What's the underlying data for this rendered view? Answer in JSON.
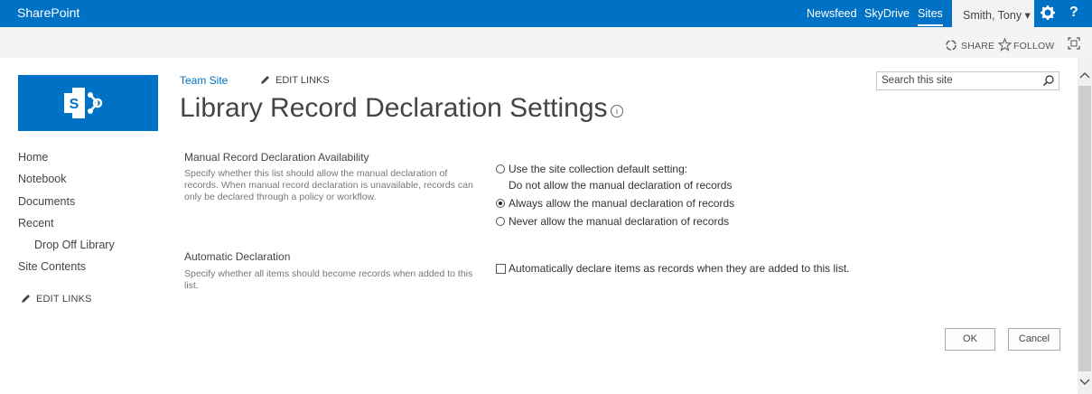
{
  "suitebar": {
    "brand": "SharePoint",
    "links": [
      "Newsfeed",
      "SkyDrive",
      "Sites"
    ],
    "user": "Smith, Tony ▾",
    "help": "?"
  },
  "ribbon": {
    "share": "SHARE",
    "follow": "FOLLOW"
  },
  "header": {
    "breadcrumb": "Team Site",
    "edit_links": "EDIT LINKS",
    "title": "Library Record Declaration Settings",
    "info_glyph": "i"
  },
  "search": {
    "placeholder": "Search this site"
  },
  "leftnav": {
    "items": [
      "Home",
      "Notebook",
      "Documents",
      "Recent"
    ],
    "sub_item": "Drop Off Library",
    "site_contents": "Site Contents",
    "edit_links": "EDIT LINKS"
  },
  "manual": {
    "title": "Manual Record Declaration Availability",
    "desc": "Specify whether this list should allow the manual declaration of records.  When manual record declaration is unavailable, records can only be declared through a policy or workflow.",
    "opt_default_line1": "Use the site collection default setting:",
    "opt_default_line2": "Do not allow the manual declaration of records",
    "opt_always": "Always allow the manual declaration of records",
    "opt_never": "Never allow the manual declaration of records",
    "selected": "always"
  },
  "automatic": {
    "title": "Automatic Declaration",
    "desc": "Specify whether all items should become records when added to this list.",
    "checkbox_label": "Automatically declare items as records when they are added to this list.",
    "checked": false
  },
  "buttons": {
    "ok": "OK",
    "cancel": "Cancel"
  },
  "colors": {
    "suitebar": "#0072c6",
    "logo": "#0072c6",
    "link": "#0072c6"
  }
}
